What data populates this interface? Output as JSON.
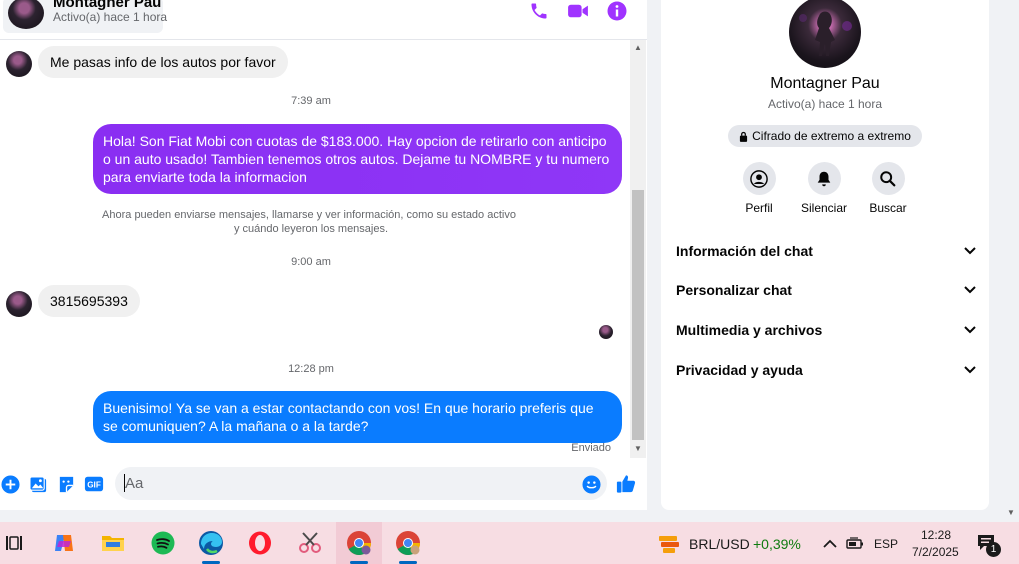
{
  "contact": {
    "name": "Montagner Pau",
    "status": "Activo(a) hace 1 hora"
  },
  "messages": {
    "incoming_1": "Me pasas info de los autos por favor",
    "time_1": "7:39 am",
    "outgoing_1": "Hola! Son Fiat Mobi con cuotas de $183.000. Hay opcion de retirarlo con anticipo o un auto usado! Tambien tenemos otros autos. Dejame tu NOMBRE y tu numero para enviarte toda la informacion",
    "system_notice_line1": "Ahora pueden enviarse mensajes, llamarse y ver información, como su estado activo",
    "system_notice_line2": "y cuándo leyeron los mensajes.",
    "time_2": "9:00 am",
    "incoming_2": "3815695393",
    "time_3": "12:28 pm",
    "outgoing_2": "Buenisimo! Ya se van a estar contactando con vos! En que horario preferis que se comuniquen? A la mañana o a la tarde?",
    "sent_status": "Enviado"
  },
  "composer": {
    "placeholder": "Aa"
  },
  "info_panel": {
    "name": "Montagner Pau",
    "status": "Activo(a) hace 1 hora",
    "encryption": "Cifrado de extremo a extremo",
    "actions": [
      {
        "label": "Perfil",
        "icon": "profile-icon"
      },
      {
        "label": "Silenciar",
        "icon": "bell-icon"
      },
      {
        "label": "Buscar",
        "icon": "search-icon"
      }
    ],
    "sections": [
      "Información del chat",
      "Personalizar chat",
      "Multimedia y archivos",
      "Privacidad y ayuda"
    ]
  },
  "taskbar": {
    "ticker_label": "BRL/USD",
    "ticker_change": "+0,39%",
    "language": "ESP",
    "time": "12:28",
    "date": "7/2/2025",
    "notification_count": "1"
  },
  "colors": {
    "messenger_blue": "#0a7cff",
    "outgoing_purple": "#8b2cf5",
    "header_icon": "#a033ff",
    "ticker_positive": "#0f7b0f"
  }
}
